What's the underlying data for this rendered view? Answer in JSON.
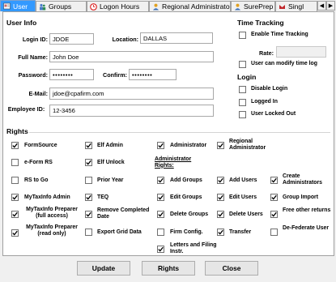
{
  "tabs": [
    {
      "label": "User",
      "icon": "user-icon",
      "active": true
    },
    {
      "label": "Groups",
      "icon": "groups-icon",
      "active": false
    },
    {
      "label": "Logon Hours",
      "icon": "clock-icon",
      "active": false
    },
    {
      "label": "Regional Administrator",
      "icon": "regional-admin-icon",
      "active": false
    },
    {
      "label": "SurePrep",
      "icon": "sureprep-icon",
      "active": false
    },
    {
      "label": "Singl",
      "icon": "single-icon",
      "active": false
    }
  ],
  "user_info": {
    "heading": "User Info",
    "login_id_label": "Login ID:",
    "login_id": "JDOE",
    "location_label": "Location:",
    "location": "DALLAS",
    "full_name_label": "Full Name:",
    "full_name": "John Doe",
    "password_label": "Password:",
    "password": "••••••••",
    "confirm_label": "Confirm:",
    "confirm": "••••••••",
    "email_label": "E-Mail:",
    "email": "jdoe@cpafirm.com",
    "employee_id_label": "Employee ID:",
    "employee_id": "12-3456"
  },
  "time_tracking": {
    "heading": "Time Tracking",
    "enable_label": "Enable Time Tracking",
    "enable_checked": false,
    "rate_label": "Rate:",
    "rate": "",
    "modify_label": "User can modify time log",
    "modify_checked": false
  },
  "login": {
    "heading": "Login",
    "disable_label": "Disable Login",
    "disable_checked": false,
    "logged_in_label": "Logged In",
    "logged_in_checked": false,
    "locked_label": "User Locked Out",
    "locked_checked": false
  },
  "rights": {
    "heading": "Rights",
    "admin_rights_label": "Administrator Rights:",
    "items": [
      {
        "label": "FormSource",
        "checked": true
      },
      {
        "label": "Elf Admin",
        "checked": true
      },
      {
        "label": "Administrator",
        "checked": true
      },
      {
        "label": "Regional Administrator",
        "checked": true
      },
      {
        "label": "e-Form RS",
        "checked": false
      },
      {
        "label": "Elf Unlock",
        "checked": true
      },
      {
        "label": "RS to Go",
        "checked": false
      },
      {
        "label": "Prior Year",
        "checked": false
      },
      {
        "label": "Add Groups",
        "checked": true
      },
      {
        "label": "Add Users",
        "checked": true
      },
      {
        "label": "Create Administrators",
        "checked": true
      },
      {
        "label": "MyTaxInfo Admin",
        "checked": true
      },
      {
        "label": "TEQ",
        "checked": true
      },
      {
        "label": "Edit Groups",
        "checked": true
      },
      {
        "label": "Edit Users",
        "checked": true
      },
      {
        "label": "Group Import",
        "checked": true
      },
      {
        "label": "MyTaxInfo Preparer (full access)",
        "checked": true
      },
      {
        "label": "Remove Completed Date",
        "checked": true
      },
      {
        "label": "Delete Groups",
        "checked": true
      },
      {
        "label": "Delete Users",
        "checked": true
      },
      {
        "label": "Free other returns",
        "checked": true
      },
      {
        "label": "MyTaxInfo Preparer (read only)",
        "checked": true
      },
      {
        "label": "Export Grid Data",
        "checked": false
      },
      {
        "label": "Firm Config.",
        "checked": false
      },
      {
        "label": "Transfer",
        "checked": true
      },
      {
        "label": "De-Federate User",
        "checked": false
      },
      {
        "label": "Letters and Filing Instr.",
        "checked": true
      }
    ]
  },
  "buttons": {
    "update": "Update",
    "rights": "Rights",
    "close": "Close"
  },
  "colors": {
    "active_tab": "#3399ff",
    "panel_bg": "#ffffff",
    "window_bg": "#f0f0f0"
  }
}
